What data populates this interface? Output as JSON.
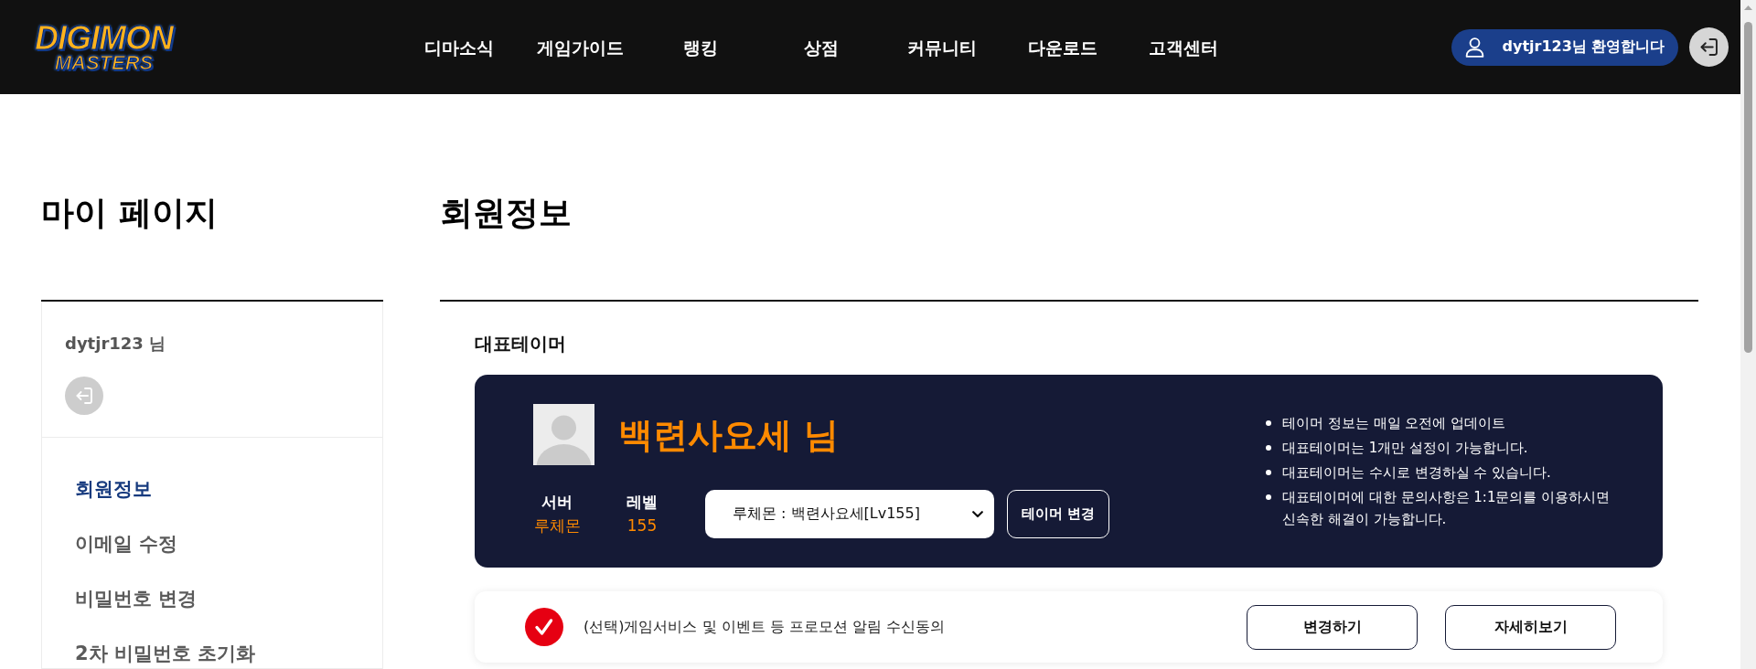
{
  "header": {
    "logo": {
      "lines": [
        "DIGIMON",
        "MASTERS"
      ]
    },
    "nav": [
      "디마소식",
      "게임가이드",
      "랭킹",
      "상점",
      "커뮤니티",
      "다운로드",
      "고객센터"
    ],
    "welcome": "dytjr123님 환영합니다"
  },
  "sidebar": {
    "title": "마이 페이지",
    "user": "dytjr123 님",
    "menu": [
      {
        "label": "회원정보",
        "selected": true
      },
      {
        "label": "이메일 수정",
        "selected": false
      },
      {
        "label": "비밀번호 변경",
        "selected": false
      },
      {
        "label": "2차 비밀번호 초기화",
        "selected": false
      }
    ]
  },
  "main": {
    "title": "회원정보",
    "section_title": "대표테이머",
    "tamer": {
      "name": "백련사요세 님",
      "stats": [
        {
          "label": "서버",
          "value": "루체몬"
        },
        {
          "label": "레벨",
          "value": "155"
        }
      ],
      "select": {
        "value": "루체몬 : 백련사요세[Lv155]"
      },
      "change_button": "테이머 변경",
      "notes": [
        "테이머 정보는 매일 오전에 업데이트",
        "대표테이머는 1개만 설정이 가능합니다.",
        "대표테이머는 수시로 변경하실 수 있습니다.",
        "대표테이머에 대한 문의사항은 1:1문의를 이용하시면 신속한 해결이 가능합니다."
      ]
    },
    "consent": {
      "checked": true,
      "text": "(선택)게임서비스 및 이벤트 등 프로모션 알림 수신동의",
      "buttons": [
        "변경하기",
        "자세히보기"
      ]
    }
  }
}
